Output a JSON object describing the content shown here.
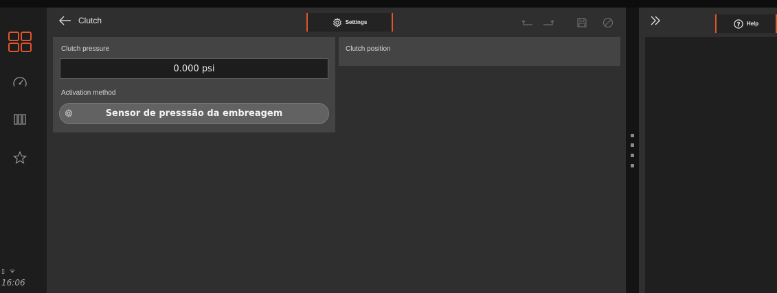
{
  "header": {
    "title": "Clutch",
    "settings_label": "Settings"
  },
  "cards": {
    "pressure": {
      "label": "Clutch pressure",
      "value": "0.000 psi",
      "activation_label": "Activation method",
      "activation_value": "Sensor de presssão da embreagem"
    },
    "position": {
      "label": "Clutch position"
    }
  },
  "help": {
    "label": "Help"
  },
  "status": {
    "time": "16:06"
  },
  "icons": {
    "home": "home-grid-icon",
    "dashboard": "gauge-icon",
    "bars": "bars-icon",
    "favorites": "star-icon",
    "back": "arrow-left-icon",
    "settings": "gear-icon",
    "undo": "undo-icon",
    "redo": "redo-icon",
    "save": "save-icon",
    "cancel": "cancel-icon",
    "expand": "double-chevron-right-icon",
    "help": "help-circle-icon"
  },
  "colors": {
    "accent": "#e0552b",
    "surface": "#2f2f2f",
    "card": "#444444"
  }
}
